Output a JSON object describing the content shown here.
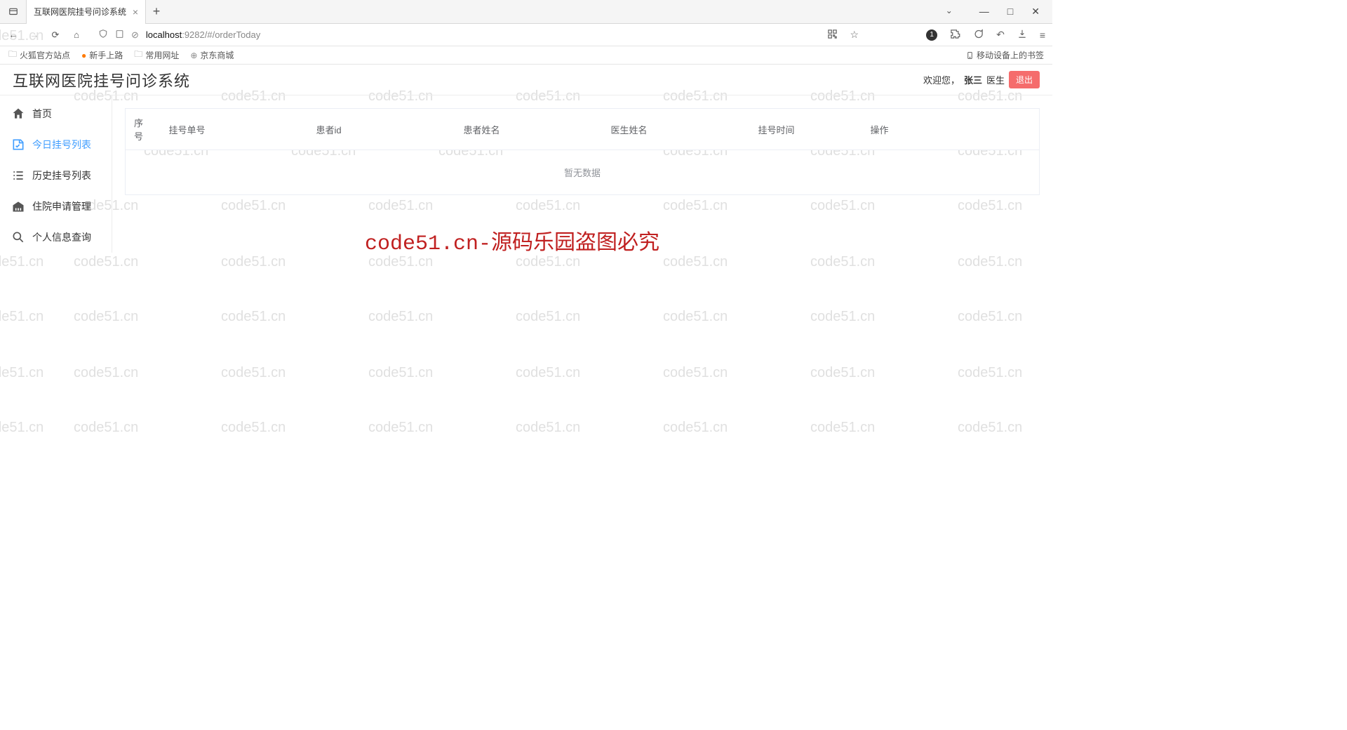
{
  "browser": {
    "tab_title": "互联网医院挂号问诊系统",
    "url_host": "localhost",
    "url_port_path": ":9282/#/orderToday",
    "bookmarks": [
      "火狐官方站点",
      "新手上路",
      "常用网址",
      "京东商城"
    ],
    "mobile_bookmarks_label": "移动设备上的书签",
    "badge_count": "1"
  },
  "app_header": {
    "title": "互联网医院挂号问诊系统",
    "welcome_prefix": "欢迎您，",
    "username": "张三",
    "role": "医生",
    "logout_label": "退出"
  },
  "sidebar": {
    "items": [
      {
        "label": "首页"
      },
      {
        "label": "今日挂号列表"
      },
      {
        "label": "历史挂号列表"
      },
      {
        "label": "住院申请管理"
      },
      {
        "label": "个人信息查询"
      }
    ]
  },
  "table": {
    "columns": [
      "序号",
      "挂号单号",
      "患者id",
      "患者姓名",
      "医生姓名",
      "挂号时间",
      "操作"
    ],
    "empty_text": "暂无数据"
  },
  "watermark": {
    "text": "code51.cn",
    "banner": "code51.cn-源码乐园盗图必究"
  }
}
